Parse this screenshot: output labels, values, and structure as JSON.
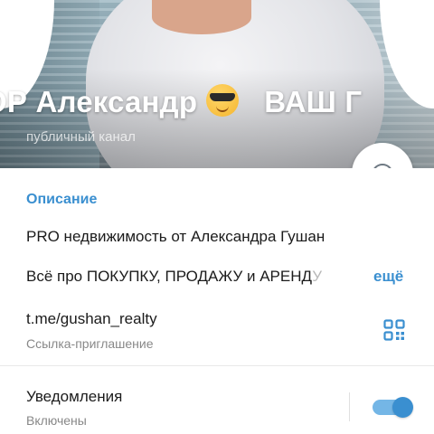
{
  "header": {
    "title_part1": "ОР Александр",
    "title_emoji": "sunglasses-emoji",
    "title_part2": "ВАШ Г",
    "subtitle": "публичный канал"
  },
  "actions": {
    "message_icon": "chat-bubble-icon"
  },
  "description": {
    "label": "Описание",
    "line1": "PRO недвижимость от Александра Гушан",
    "line2": "Всё про ПОКУПКУ,  ПРОДАЖУ  и АРЕНД",
    "line2_fade": "У",
    "more": "ещё"
  },
  "invite_link": {
    "value": "t.me/gushan_realty",
    "caption": "Ссылка-приглашение",
    "icon": "qr-code-icon"
  },
  "notifications": {
    "label": "Уведомления",
    "status": "Включены",
    "enabled": true
  },
  "colors": {
    "accent": "#3a8fd0",
    "toggle_track": "#74b6e6"
  }
}
